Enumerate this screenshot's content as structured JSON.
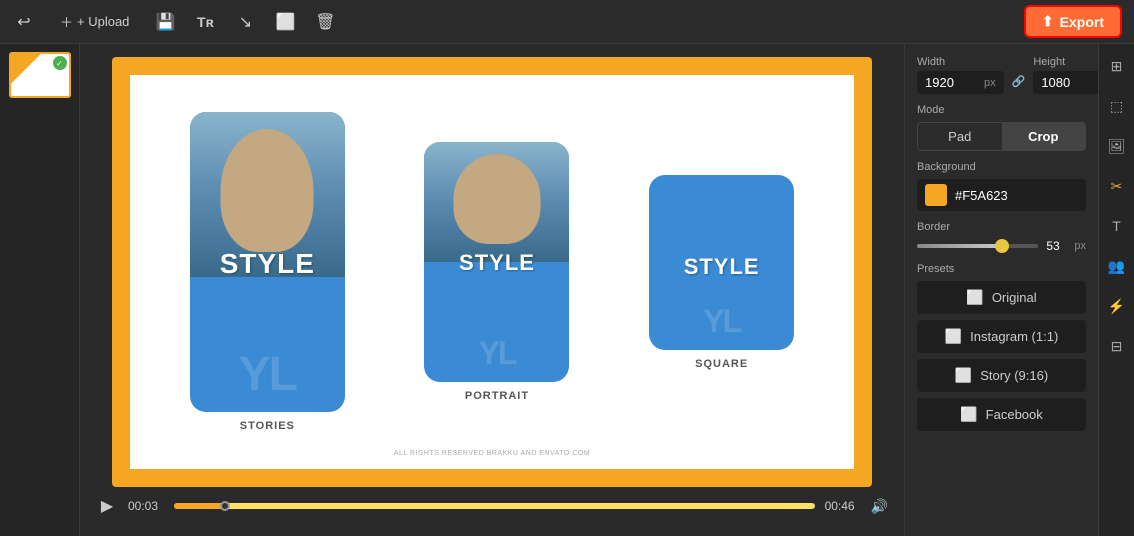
{
  "toolbar": {
    "upload_label": "+ Upload",
    "export_label": "Export"
  },
  "canvas": {
    "cards": [
      {
        "label": "STYLE",
        "caption": "STORIES",
        "watermark": "YL",
        "size": "stories"
      },
      {
        "label": "STYLE",
        "caption": "PORTRAIT",
        "watermark": "YL",
        "size": "portrait"
      },
      {
        "label": "STYLE",
        "caption": "SQUARE",
        "watermark": "YL",
        "size": "square"
      }
    ],
    "copyright": "ALL RIGHTS RESERVED BRAKKU AND ENVATO.COM"
  },
  "playback": {
    "time_current": "00:03",
    "time_total": "00:46"
  },
  "right_panel": {
    "width_label": "Width",
    "height_label": "Height",
    "width_value": "1920",
    "height_value": "1080",
    "unit": "px",
    "mode_label": "Mode",
    "mode_pad": "Pad",
    "mode_crop": "Crop",
    "bg_label": "Background",
    "bg_hex": "#F5A623",
    "border_label": "Border",
    "border_value": "53",
    "border_unit": "px",
    "presets_label": "Presets",
    "preset_original": "Original",
    "preset_instagram": "Instagram (1:1)",
    "preset_story": "Story (9:16)",
    "preset_facebook": "Facebook"
  }
}
